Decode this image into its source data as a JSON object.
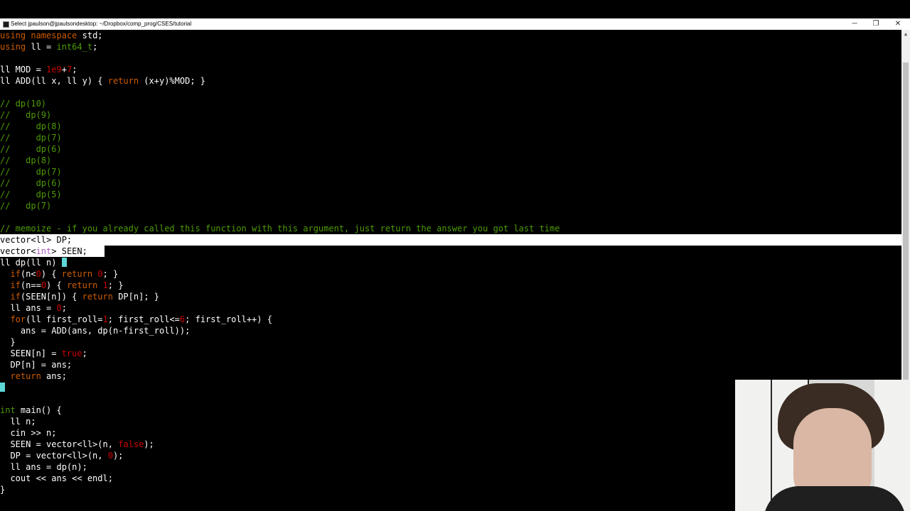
{
  "window": {
    "title": "Select jpaulson@jpaulsondesktop: ~/Dropbox/comp_prog/CSES/tutorial",
    "minimize_glyph": "─",
    "restore_glyph": "❐",
    "close_glyph": "✕"
  },
  "code": {
    "l01": [
      [
        "kw",
        "using"
      ],
      [
        "p",
        " "
      ],
      [
        "kw",
        "namespace"
      ],
      [
        "p",
        " std;"
      ]
    ],
    "l02": [
      [
        "kw",
        "using"
      ],
      [
        "p",
        " ll = "
      ],
      [
        "ty",
        "int64_t"
      ],
      [
        "p",
        ";"
      ]
    ],
    "l03": [],
    "l04": [
      [
        "p",
        "ll MOD = "
      ],
      [
        "num",
        "1e9"
      ],
      [
        "p",
        "+"
      ],
      [
        "num",
        "7"
      ],
      [
        "p",
        ";"
      ]
    ],
    "l05": [
      [
        "p",
        "ll ADD(ll x, ll y) { "
      ],
      [
        "kw",
        "return"
      ],
      [
        "p",
        " (x+y)%MOD; }"
      ]
    ],
    "l06": [],
    "l07": [
      [
        "cm",
        "// dp(10)"
      ]
    ],
    "l08": [
      [
        "cm",
        "//   dp(9)"
      ]
    ],
    "l09": [
      [
        "cm",
        "//     dp(8)"
      ]
    ],
    "l10": [
      [
        "cm",
        "//     dp(7)"
      ]
    ],
    "l11": [
      [
        "cm",
        "//     dp(6)"
      ]
    ],
    "l12": [
      [
        "cm",
        "//   dp(8)"
      ]
    ],
    "l13": [
      [
        "cm",
        "//     dp(7)"
      ]
    ],
    "l14": [
      [
        "cm",
        "//     dp(6)"
      ]
    ],
    "l15": [
      [
        "cm",
        "//     dp(5)"
      ]
    ],
    "l16": [
      [
        "cm",
        "//   dp(7)"
      ]
    ],
    "l17": [],
    "l18": [
      [
        "cm",
        "// memoize - if you already called this function with this argument, just return the answer you got last time"
      ]
    ],
    "l19": [
      [
        "p",
        "vector<ll> DP;"
      ]
    ],
    "l20": [
      [
        "p",
        "vector<"
      ],
      [
        "ty",
        "int"
      ],
      [
        "p",
        "> SEEN;"
      ]
    ],
    "l21": [
      [
        "p",
        "ll dp(ll n) "
      ]
    ],
    "l22": [
      [
        "p",
        "  "
      ],
      [
        "kw",
        "if"
      ],
      [
        "p",
        "(n<"
      ],
      [
        "num",
        "0"
      ],
      [
        "p",
        ") { "
      ],
      [
        "kw",
        "return"
      ],
      [
        "p",
        " "
      ],
      [
        "num",
        "0"
      ],
      [
        "p",
        "; }"
      ]
    ],
    "l23": [
      [
        "p",
        "  "
      ],
      [
        "kw",
        "if"
      ],
      [
        "p",
        "(n=="
      ],
      [
        "num",
        "0"
      ],
      [
        "p",
        ") { "
      ],
      [
        "kw",
        "return"
      ],
      [
        "p",
        " "
      ],
      [
        "num",
        "1"
      ],
      [
        "p",
        "; }"
      ]
    ],
    "l24": [
      [
        "p",
        "  "
      ],
      [
        "kw",
        "if"
      ],
      [
        "p",
        "(SEEN[n]) { "
      ],
      [
        "kw",
        "return"
      ],
      [
        "p",
        " DP[n]; }"
      ]
    ],
    "l25": [
      [
        "p",
        "  ll ans = "
      ],
      [
        "num",
        "0"
      ],
      [
        "p",
        ";"
      ]
    ],
    "l26": [
      [
        "p",
        "  "
      ],
      [
        "kw",
        "for"
      ],
      [
        "p",
        "(ll first_roll="
      ],
      [
        "num",
        "1"
      ],
      [
        "p",
        "; first_roll<="
      ],
      [
        "num",
        "6"
      ],
      [
        "p",
        "; first_roll++) {"
      ]
    ],
    "l27": [
      [
        "p",
        "    ans = ADD(ans, dp(n-first_roll));"
      ]
    ],
    "l28": [
      [
        "p",
        "  }"
      ]
    ],
    "l29": [
      [
        "p",
        "  SEEN[n] = "
      ],
      [
        "num",
        "true"
      ],
      [
        "p",
        ";"
      ]
    ],
    "l30": [
      [
        "p",
        "  DP[n] = ans;"
      ]
    ],
    "l31": [
      [
        "p",
        "  "
      ],
      [
        "kw",
        "return"
      ],
      [
        "p",
        " ans;"
      ]
    ],
    "l32": [],
    "l33": [],
    "l34": [
      [
        "ty",
        "int"
      ],
      [
        "p",
        " main() {"
      ]
    ],
    "l35": [
      [
        "p",
        "  ll n;"
      ]
    ],
    "l36": [
      [
        "p",
        "  cin >> n;"
      ]
    ],
    "l37": [
      [
        "p",
        "  SEEN = vector<ll>(n, "
      ],
      [
        "num",
        "false"
      ],
      [
        "p",
        ");"
      ]
    ],
    "l38": [
      [
        "p",
        "  DP = vector<ll>(n, "
      ],
      [
        "num",
        "0"
      ],
      [
        "p",
        ");"
      ]
    ],
    "l39": [
      [
        "p",
        "  ll ans = dp(n);"
      ]
    ],
    "l40": [
      [
        "p",
        "  cout << ans << endl;"
      ]
    ],
    "l41": [
      [
        "p",
        "}"
      ]
    ]
  },
  "colors": {
    "background": "#000000",
    "text": "#ffffff",
    "keyword": "#ce5c00",
    "type_comment": "#4e9a06",
    "number": "#cc0000",
    "cursor": "#5fd7d7",
    "selection": "#ffffff"
  },
  "icons": {
    "app": "terminal-icon",
    "minimize": "minimize-icon",
    "restore": "restore-icon",
    "close": "close-icon"
  }
}
